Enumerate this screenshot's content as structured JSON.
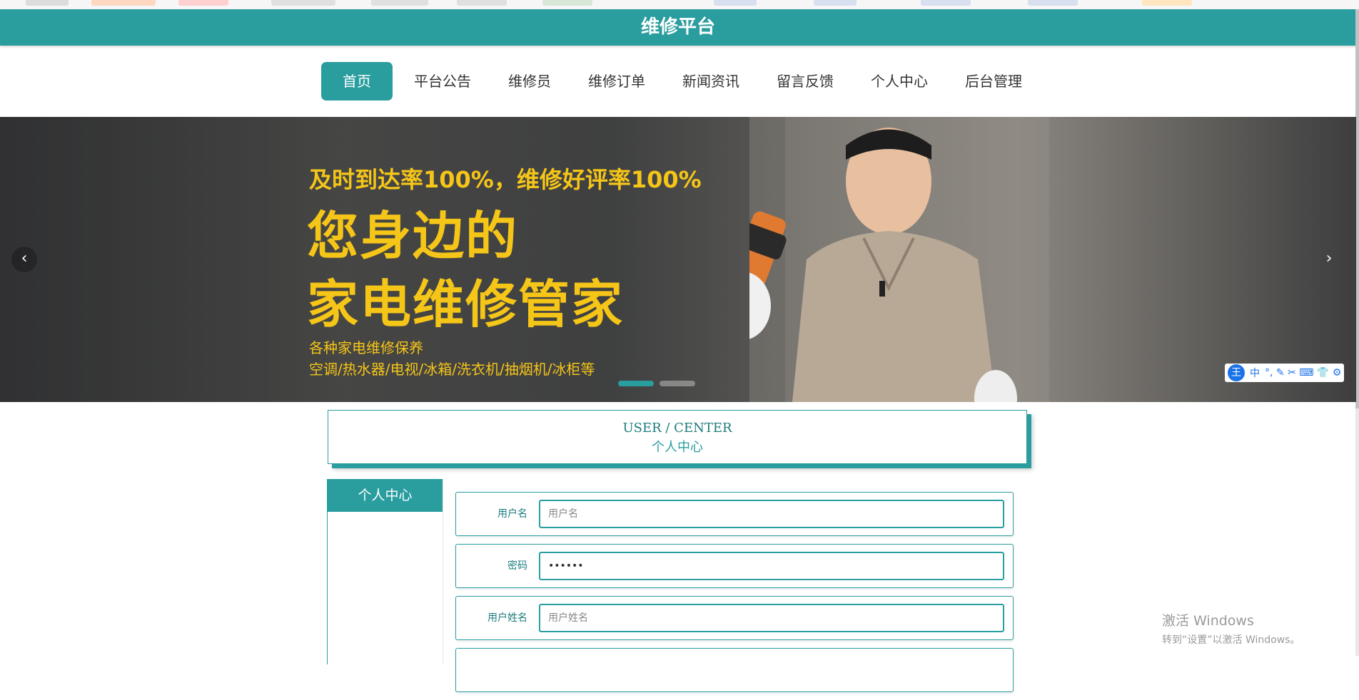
{
  "header": {
    "title": "维修平台"
  },
  "nav": {
    "items": [
      "首页",
      "平台公告",
      "维修员",
      "维修订单",
      "新闻资讯",
      "留言反馈",
      "个人中心",
      "后台管理"
    ],
    "active": "首页"
  },
  "banner": {
    "line1": "及时到达率100%，维修好评率100%",
    "line2": "您身边的",
    "line3": "家电维修管家",
    "line4": "各种家电维修保养",
    "line5": "空调/热水器/电视/冰箱/洗衣机/抽烟机/冰柜等",
    "prev_icon": "‹",
    "next_icon": "›"
  },
  "ime": {
    "logo": "王",
    "mode": "中",
    "icons": "°, ✎ ✂ ⌨ 👕 ⚙"
  },
  "section": {
    "title_en": "USER / CENTER",
    "title_cn": "个人中心"
  },
  "sidebar": {
    "heading": "个人中心"
  },
  "form": {
    "username": {
      "label": "用户名",
      "placeholder": "用户名",
      "value": ""
    },
    "password": {
      "label": "密码",
      "value": "••••••"
    },
    "realname": {
      "label": "用户姓名",
      "placeholder": "用户姓名",
      "value": ""
    }
  },
  "watermark": {
    "line1": "激活 Windows",
    "line2": "转到“设置”以激活 Windows。"
  },
  "colors": {
    "primary": "#2a9d9f",
    "banner_text": "#f5c518"
  }
}
